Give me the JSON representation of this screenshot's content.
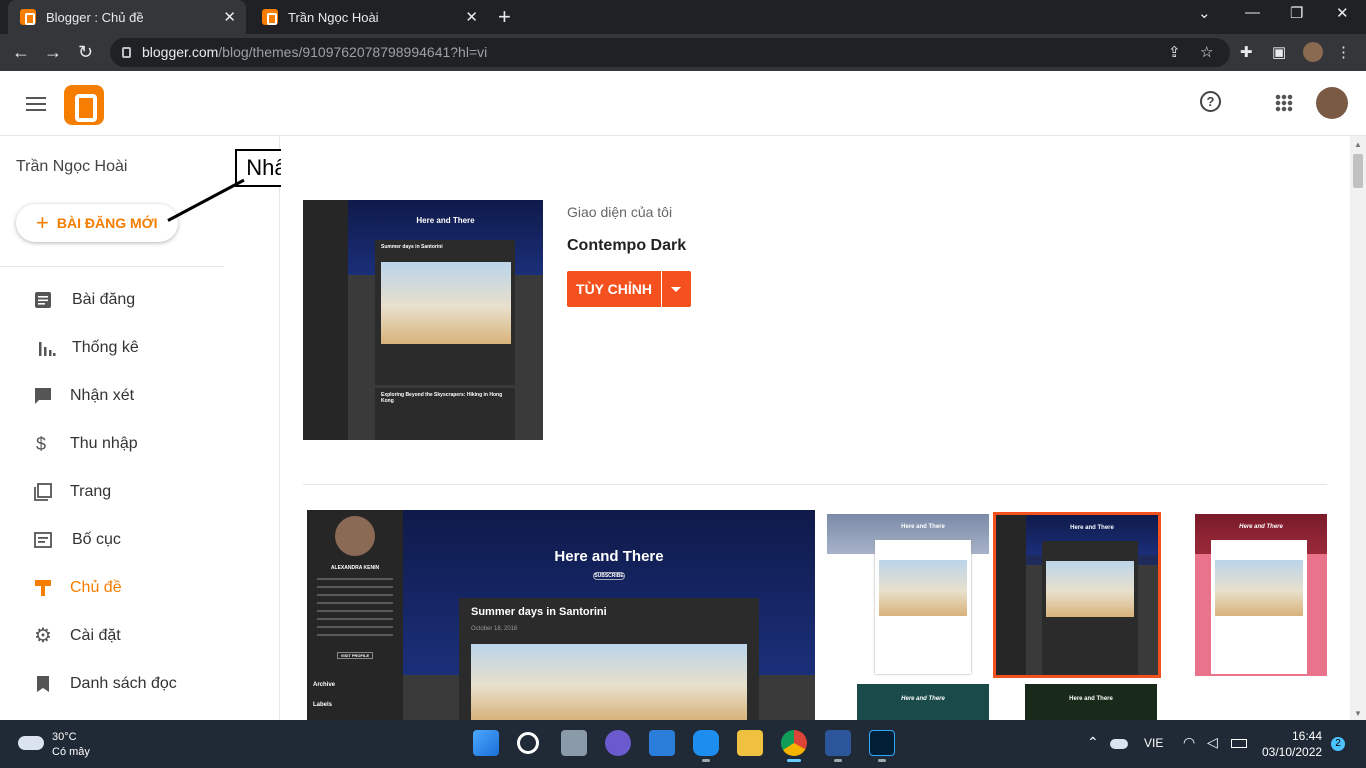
{
  "browser": {
    "tabs": [
      {
        "title": "Blogger : Chủ đề"
      },
      {
        "title": "Trần Ngọc Hoài"
      }
    ],
    "url_main": "blogger.com",
    "url_rest": "/blog/themes/9109762078798994641?hl=vi"
  },
  "appbar": {
    "help_symbol": "?"
  },
  "sidebar": {
    "user_name": "Trần Ngọc Hoài",
    "new_post_label": "BÀI ĐĂNG MỚI",
    "items": [
      {
        "label": "Bài đăng",
        "icon": "posts-icon"
      },
      {
        "label": "Thống kê",
        "icon": "stats-icon"
      },
      {
        "label": "Nhận xét",
        "icon": "comments-icon"
      },
      {
        "label": "Thu nhập",
        "icon": "dollar-icon"
      },
      {
        "label": "Trang",
        "icon": "pages-icon"
      },
      {
        "label": "Bố cục",
        "icon": "layout-icon"
      },
      {
        "label": "Chủ đề",
        "icon": "theme-icon",
        "active": true
      },
      {
        "label": "Cài đặt",
        "icon": "gear-icon"
      },
      {
        "label": "Danh sách đọc",
        "icon": "bookmark-icon"
      }
    ]
  },
  "annotation": {
    "callout_text": "Nhấp chọn"
  },
  "current_theme": {
    "section_label": "Giao diện của tôi",
    "name": "Contempo Dark",
    "customize_label": "TÙY CHỈNH"
  },
  "preview": {
    "blog_title": "Here and There",
    "post_title": "Summer days in Santorini",
    "post_date": "October 18, 2016",
    "second_post": "Exploring Beyond the Skyscrapers: Hiking in Hong Kong",
    "author": "ALEXANDRA KENIN",
    "subscribe": "SUBSCRIBE",
    "archive": "Archive",
    "labels": "Labels",
    "visit_profile": "VISIT PROFILE"
  },
  "taskbar": {
    "temperature": "30°C",
    "weather": "Có mây",
    "language": "VIE",
    "time": "16:44",
    "date": "03/10/2022",
    "notifications": "2"
  },
  "colors": {
    "accent": "#f57d00",
    "button": "#f4511e",
    "selected_border": "#f4511e"
  }
}
